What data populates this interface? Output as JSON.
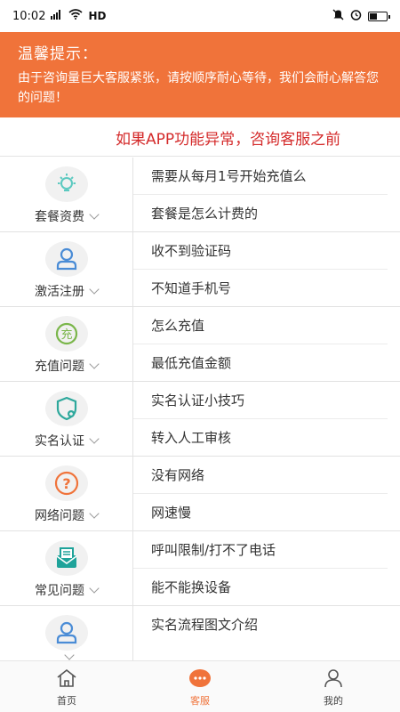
{
  "status_bar": {
    "time": "10:02",
    "network": "HD",
    "battery_level": 0.45
  },
  "notice": {
    "title": "温馨提示：",
    "body": "由于咨询量巨大客服紧张，请按顺序耐心等待，我们会耐心解答您的问题！"
  },
  "marquee": {
    "text": "如果APP功能异常，咨询客服之前"
  },
  "colors": {
    "accent": "#f0733a",
    "marquee_text": "#d42a2a"
  },
  "categories": [
    {
      "label": "套餐资费",
      "icon": "lightbulb-icon",
      "questions": [
        "需要从每月1号开始充值么",
        "套餐是怎么计费的"
      ]
    },
    {
      "label": "激活注册",
      "icon": "user-icon",
      "questions": [
        "收不到验证码",
        "不知道手机号"
      ]
    },
    {
      "label": "充值问题",
      "icon": "recharge-icon",
      "questions": [
        "怎么充值",
        "最低充值金额"
      ]
    },
    {
      "label": "实名认证",
      "icon": "shield-icon",
      "questions": [
        "实名认证小技巧",
        "转入人工审核"
      ]
    },
    {
      "label": "网络问题",
      "icon": "question-icon",
      "questions": [
        "没有网络",
        "网速慢"
      ]
    },
    {
      "label": "常见问题",
      "icon": "mail-icon",
      "questions": [
        "呼叫限制/打不了电话",
        "能不能换设备"
      ]
    },
    {
      "label": "",
      "icon": "user-icon",
      "questions": [
        "实名流程图文介绍"
      ]
    }
  ],
  "bottom_nav": [
    {
      "label": "首页",
      "icon": "home-icon"
    },
    {
      "label": "客服",
      "icon": "chat-icon"
    },
    {
      "label": "我的",
      "icon": "profile-icon"
    }
  ]
}
